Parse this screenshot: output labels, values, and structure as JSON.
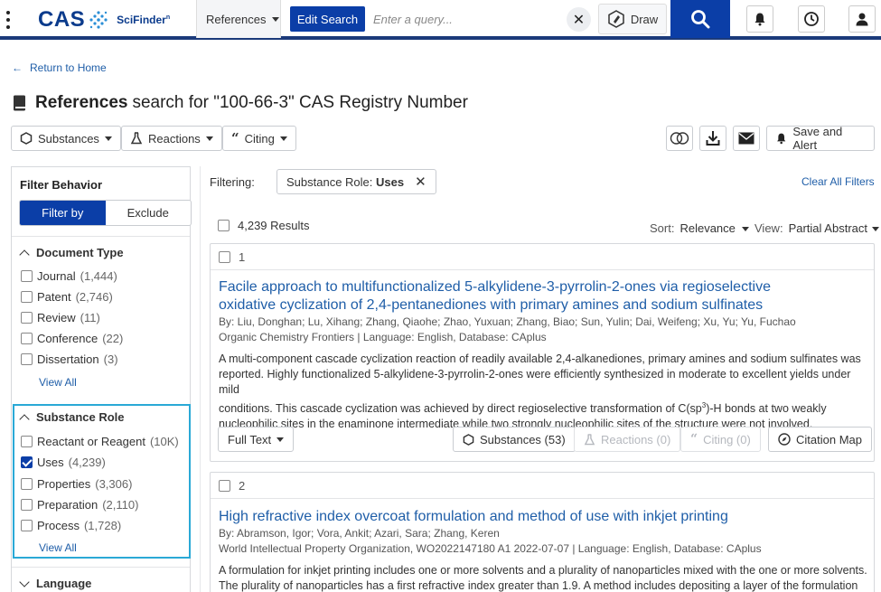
{
  "topbar": {
    "logo_text": "CAS",
    "product_name": "SciFinder",
    "product_sup": "n",
    "search_type": "References",
    "edit_search_label": "Edit Search",
    "query_placeholder": "Enter a query...",
    "draw_label": "Draw"
  },
  "header": {
    "back_label": "Return to Home",
    "title_bold": "References",
    "title_rest": "search for \"100-66-3\" CAS Registry Number"
  },
  "toolbar": {
    "substances_label": "Substances",
    "reactions_label": "Reactions",
    "citing_label": "Citing",
    "save_alert_label": "Save and Alert"
  },
  "sidebar": {
    "filter_behavior_title": "Filter Behavior",
    "filter_by_label": "Filter by",
    "exclude_label": "Exclude",
    "document_type": {
      "title": "Document Type",
      "items": [
        {
          "label": "Journal",
          "count": "(1,444)"
        },
        {
          "label": "Patent",
          "count": "(2,746)"
        },
        {
          "label": "Review",
          "count": "(11)"
        },
        {
          "label": "Conference",
          "count": "(22)"
        },
        {
          "label": "Dissertation",
          "count": "(3)"
        }
      ],
      "view_all": "View All"
    },
    "substance_role": {
      "title": "Substance Role",
      "items": [
        {
          "label": "Reactant or Reagent",
          "count": "(10K)",
          "checked": false
        },
        {
          "label": "Uses",
          "count": "(4,239)",
          "checked": true
        },
        {
          "label": "Properties",
          "count": "(3,306)",
          "checked": false
        },
        {
          "label": "Preparation",
          "count": "(2,110)",
          "checked": false
        },
        {
          "label": "Process",
          "count": "(1,728)",
          "checked": false
        }
      ],
      "view_all": "View All"
    },
    "language_title": "Language"
  },
  "filters": {
    "filtering_label": "Filtering:",
    "chip_prefix": "Substance Role:",
    "chip_value": "Uses",
    "clear_all": "Clear All Filters"
  },
  "results": {
    "count_label": "4,239 Results",
    "sort_label": "Sort:",
    "sort_value": "Relevance",
    "view_label": "View:",
    "view_value": "Partial Abstract"
  },
  "cards": [
    {
      "number": "1",
      "title_line1": "Facile approach to multifunctionalized 5-alkylidene-3-pyrrolin-2-ones via regioselective",
      "title_line2": "oxidative cyclization of 2,4-pentanediones with primary amines and sodium sulfinates",
      "authors": "By: Liu, Donghan; Lu, Xihang; Zhang, Qiaohe; Zhao, Yuxuan; Zhang, Biao; Sun, Yulin; Dai, Weifeng; Xu, Yu; Yu, Fuchao",
      "source": "Organic Chemistry Frontiers | Language: English, Database: CAplus",
      "abstract_l1": "A multi-component cascade cyclization reaction of readily available 2,4-alkanediones, primary amines and sodium sulfinates was",
      "abstract_l2": "reported. Highly functionalized 5-alkylidene-3-pyrrolin-2-ones were efficiently synthesized in moderate to excellent yields under mild",
      "abstract_l3a": "conditions. This cascade cyclization was achieved by direct regioselective transformation of C(sp",
      "abstract_l3sup": "3",
      "abstract_l3b": ")-H bonds at two weakly",
      "abstract_l4": "nucleophilic sites in the enaminone intermediate while two strongly nucleophilic sites of the structure were not involved.",
      "full_text_label": "Full Text",
      "substances_label": "Substances (53)",
      "reactions_label": "Reactions (0)",
      "citing_label": "Citing (0)",
      "citation_map_label": "Citation Map"
    },
    {
      "number": "2",
      "title_line1": "High refractive index overcoat formulation and method of use with inkjet printing",
      "authors": "By: Abramson, Igor; Vora, Ankit; Azari, Sara; Zhang, Keren",
      "source": "World Intellectual Property Organization, WO2022147180 A1 2022-07-07 | Language: English, Database: CAplus",
      "abstract_l1": "A formulation for inkjet printing includes one or more solvents and a plurality of nanoparticles mixed with the one or more solvents.",
      "abstract_l2": "The plurality of nanoparticles has a first refractive index greater than 1.9. A method includes depositing a layer of the formulation by"
    }
  ],
  "colors": {
    "brand_blue": "#0b3ea7",
    "link_blue": "#1f5ea8",
    "focus_cyan": "#2aa9d6"
  }
}
